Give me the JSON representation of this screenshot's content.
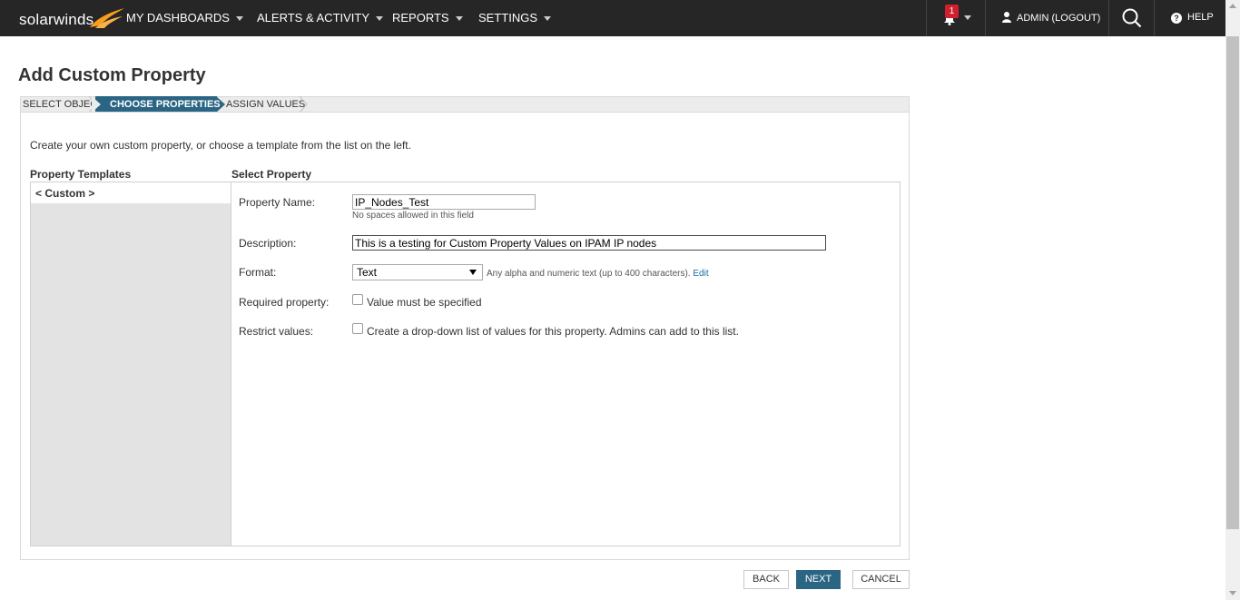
{
  "nav": {
    "logo_text": "solarwinds",
    "menus": [
      "MY DASHBOARDS",
      "ALERTS & ACTIVITY",
      "REPORTS",
      "SETTINGS"
    ],
    "notification_count": "1",
    "user_label": "ADMIN (LOGOUT)",
    "help_label": "HELP"
  },
  "page": {
    "title": "Add Custom Property"
  },
  "wizard": {
    "steps": [
      "SELECT OBJECT",
      "CHOOSE PROPERTIES",
      "ASSIGN VALUES"
    ],
    "active_step": "CHOOSE PROPERTIES"
  },
  "content": {
    "intro": "Create your own custom property, or choose a template from the list on the left.",
    "templates_heading": "Property Templates",
    "select_heading": "Select Property",
    "templates": [
      "< Custom >"
    ]
  },
  "form": {
    "name_label": "Property Name:",
    "name_value": "IP_Nodes_Test",
    "name_hint": "No spaces allowed in this field",
    "description_label": "Description:",
    "description_value": "This is a testing for Custom Property Values on IPAM IP nodes",
    "format_label": "Format:",
    "format_value": "Text",
    "format_hint": "Any alpha and numeric text (up to 400 characters).",
    "format_edit_link": "Edit",
    "required_label": "Required property:",
    "required_checkbox_label": "Value must be specified",
    "restrict_label": "Restrict values:",
    "restrict_checkbox_label": "Create a drop-down list of values for this property. Admins can add to this list."
  },
  "buttons": {
    "back": "BACK",
    "next": "NEXT",
    "cancel": "CANCEL"
  },
  "colors": {
    "topbar": "#262626",
    "accent": "#2a6584",
    "logo_orange": "#f99d1c",
    "badge": "#d0202d"
  }
}
